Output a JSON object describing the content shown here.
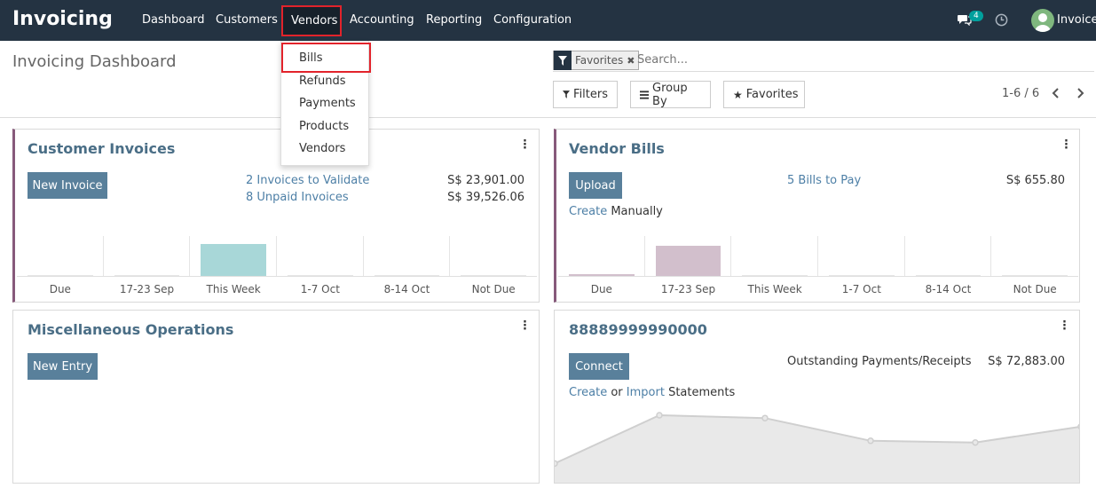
{
  "navbar": {
    "brand": "Invoicing",
    "menu": [
      "Dashboard",
      "Customers",
      "Vendors",
      "Accounting",
      "Reporting",
      "Configuration"
    ],
    "active": "Vendors",
    "message_count": "4",
    "user": "Invoice",
    "colors": {
      "bg": "#243342",
      "active_bg": "#17212b",
      "highlight": "#e2232b"
    }
  },
  "dropdown": {
    "items": [
      "Bills",
      "Refunds",
      "Payments",
      "Products",
      "Vendors"
    ],
    "highlighted": "Bills"
  },
  "control": {
    "title": "Invoicing Dashboard",
    "facet": "Favorites",
    "search_placeholder": "Search...",
    "filters_label": "Filters",
    "groupby_label": "Group By",
    "favorites_label": "Favorites",
    "pager": "1-6 / 6"
  },
  "cards": {
    "customer_invoices": {
      "title": "Customer Invoices",
      "button": "New Invoice",
      "links": [
        "2 Invoices to Validate",
        "8 Unpaid Invoices"
      ],
      "amounts": [
        "S$ 23,901.00",
        "S$ 39,526.06"
      ],
      "graph_labels": [
        "Due",
        "17-23 Sep",
        "This Week",
        "1-7 Oct",
        "8-14 Oct",
        "Not Due"
      ],
      "graph_values": [
        0.0,
        0.0,
        0.8,
        0.0,
        0.0,
        0.0
      ],
      "bar_color": "#a8d7d8"
    },
    "vendor_bills": {
      "title": "Vendor Bills",
      "button": "Upload",
      "link": "5 Bills to Pay",
      "amount": "S$ 655.80",
      "create_link": "Create",
      "create_suffix": " Manually",
      "graph_labels": [
        "Due",
        "17-23 Sep",
        "This Week",
        "1-7 Oct",
        "8-14 Oct",
        "Not Due"
      ],
      "graph_values": [
        0.05,
        0.75,
        0.0,
        0.0,
        0.0,
        0.0
      ],
      "bar_color": "#d2bfcc"
    },
    "misc": {
      "title": "Miscellaneous Operations",
      "button": "New Entry"
    },
    "bank": {
      "title": "88889999990000",
      "button": "Connect",
      "outstanding_label": "Outstanding Payments/Receipts",
      "outstanding_amount": "S$ 72,883.00",
      "create_link": "Create",
      "or_text": " or ",
      "import_link": "Import",
      "statements_text": " Statements",
      "line_values": [
        0.15,
        1.0,
        0.95,
        0.55,
        0.52,
        0.8
      ]
    }
  }
}
